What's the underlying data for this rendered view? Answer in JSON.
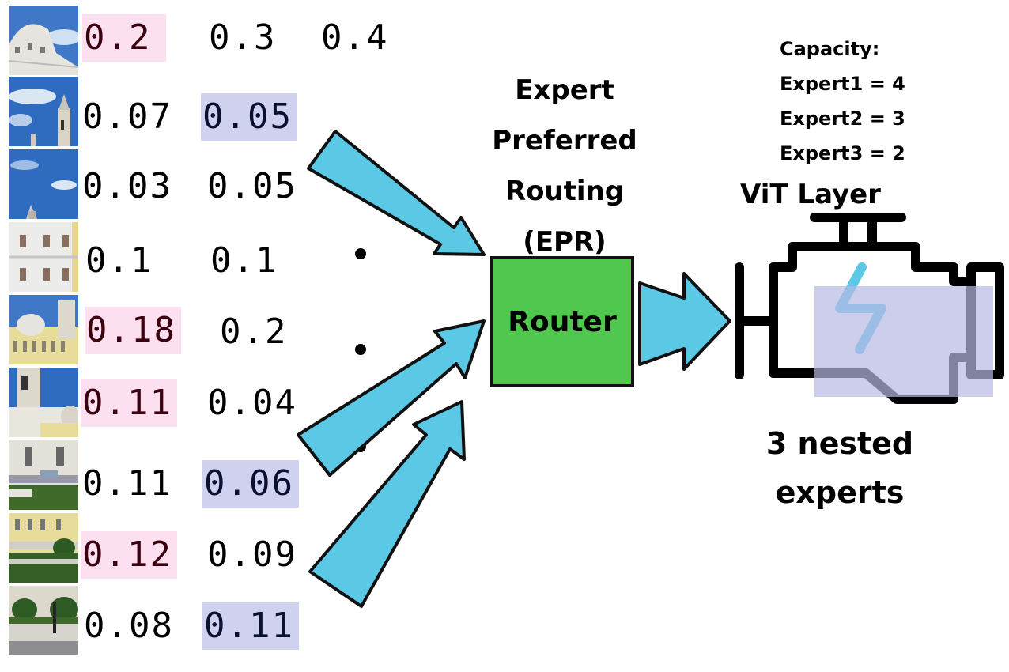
{
  "title_epr": [
    "Expert",
    "Preferred",
    "Routing",
    "(EPR)"
  ],
  "router_label": "Router",
  "capacity": {
    "heading": "Capacity:",
    "lines": [
      "Expert1 = 4",
      "Expert2 = 3",
      "Expert3 = 2"
    ]
  },
  "vit_layer_label": "ViT Layer",
  "nested_label": [
    "3 nested",
    "experts"
  ],
  "colors": {
    "arrow_fill": "#5bc8e6",
    "router_fill": "#50c850",
    "highlight_expert1": "#fde0f0",
    "highlight_expert2": "#d0d0ef",
    "lightning": "#5bc8e6"
  },
  "tokens": [
    {
      "image": "palace-dome",
      "scores": [
        "0.2",
        "0.3",
        "0.4"
      ],
      "highlight": [
        1,
        0,
        0
      ]
    },
    {
      "image": "sky-tower",
      "scores": [
        "0.07",
        "0.05"
      ],
      "highlight": [
        0,
        2
      ]
    },
    {
      "image": "sky-spire",
      "scores": [
        "0.03",
        "0.05"
      ],
      "highlight": [
        0,
        0
      ]
    },
    {
      "image": "white-facade",
      "scores": [
        "0.1",
        "0.1"
      ],
      "highlight": [
        0,
        0
      ]
    },
    {
      "image": "yellow-palace",
      "scores": [
        "0.18",
        "0.2"
      ],
      "highlight": [
        1,
        0
      ]
    },
    {
      "image": "bell-tower",
      "scores": [
        "0.11",
        "0.04"
      ],
      "highlight": [
        1,
        0
      ]
    },
    {
      "image": "street-cars",
      "scores": [
        "0.11",
        "0.06"
      ],
      "highlight": [
        0,
        2
      ]
    },
    {
      "image": "garden-facade",
      "scores": [
        "0.12",
        "0.09"
      ],
      "highlight": [
        1,
        0
      ]
    },
    {
      "image": "garden-path",
      "scores": [
        "0.08",
        "0.11"
      ],
      "highlight": [
        0,
        2
      ]
    }
  ]
}
